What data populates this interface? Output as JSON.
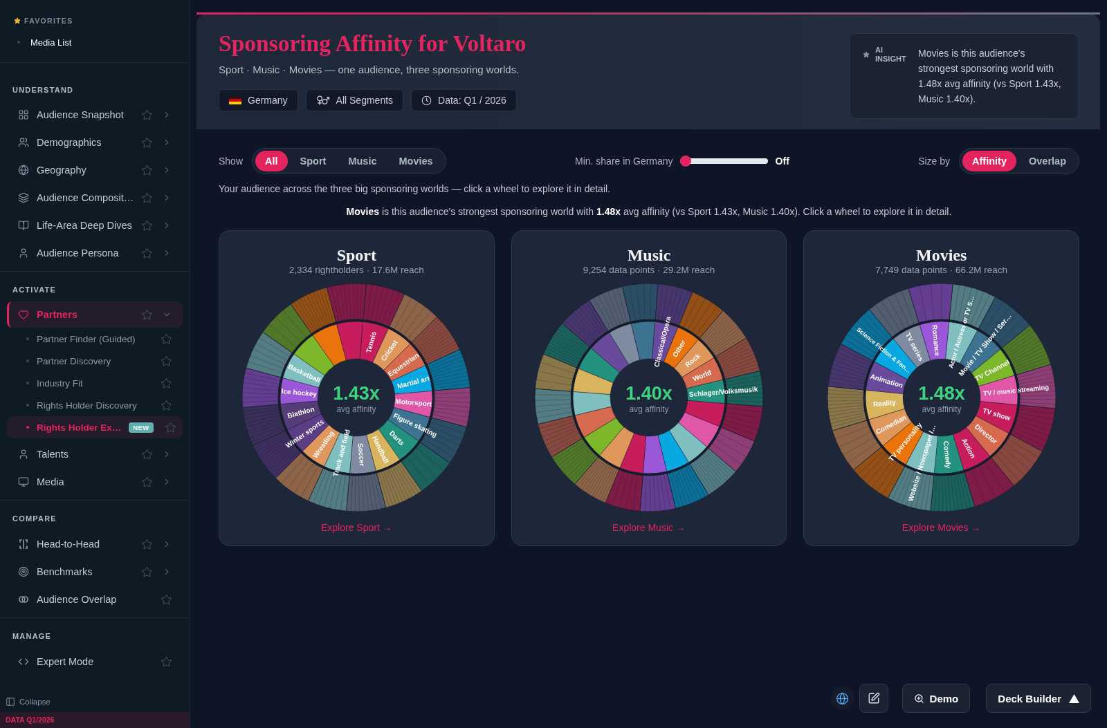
{
  "sidebar": {
    "sections": [
      {
        "kind": "favorites",
        "title": "FAVORITES",
        "items": [
          {
            "label": "Media List",
            "selected": false
          }
        ]
      },
      {
        "kind": "group",
        "title": "UNDERSTAND",
        "items": [
          {
            "label": "Audience Snapshot",
            "selected": false,
            "expanded": false
          },
          {
            "label": "Demographics",
            "selected": false,
            "expanded": false
          },
          {
            "label": "Geography",
            "selected": false,
            "expanded": false
          },
          {
            "label": "Audience Composit…",
            "selected": false,
            "expanded": false
          },
          {
            "label": "Life-Area Deep Dives",
            "selected": false,
            "expanded": false
          },
          {
            "label": "Audience Persona",
            "selected": false,
            "expanded": false
          }
        ]
      },
      {
        "kind": "group",
        "title": "ACTIVATE",
        "items": [
          {
            "label": "Partners",
            "selected": true,
            "expanded": true,
            "children": [
              {
                "label": "Partner Finder (Guided)",
                "selected": false
              },
              {
                "label": "Partner Discovery",
                "selected": false
              },
              {
                "label": "Industry Fit",
                "selected": false
              },
              {
                "label": "Rights Holder Discovery",
                "selected": false
              },
              {
                "label": "Rights Holder Ex…",
                "selected": true,
                "badge": "NEW"
              }
            ]
          },
          {
            "label": "Talents",
            "selected": false,
            "expanded": false
          },
          {
            "label": "Media",
            "selected": false,
            "expanded": false
          }
        ]
      },
      {
        "kind": "group",
        "title": "COMPARE",
        "items": [
          {
            "label": "Head-to-Head",
            "selected": false,
            "expanded": false
          },
          {
            "label": "Benchmarks",
            "selected": false,
            "expanded": false
          },
          {
            "label": "Audience Overlap",
            "selected": false
          }
        ]
      },
      {
        "kind": "group",
        "title": "MANAGE",
        "items": [
          {
            "label": "Expert Mode",
            "selected": false
          }
        ]
      }
    ],
    "collapse": "Collapse",
    "footer": "DATA Q1/2026"
  },
  "header": {
    "title": "Sponsoring Affinity for Voltaro",
    "subtitle": "Sport · Music · Movies — one audience, three sponsoring worlds.",
    "chips": [
      {
        "label": "Germany"
      },
      {
        "label": "All Segments"
      },
      {
        "label": "Data: Q1 / 2026"
      }
    ],
    "insight": {
      "label": "AI INSIGHT",
      "text": "Movies is this audience's strongest sponsoring world with 1.48x avg affinity (vs Sport 1.43x, Music 1.40x)."
    }
  },
  "controls": {
    "show": {
      "label": "Show",
      "options": [
        {
          "label": "All",
          "selected": true
        },
        {
          "label": "Sport",
          "selected": false
        },
        {
          "label": "Music",
          "selected": false
        },
        {
          "label": "Movies",
          "selected": false
        }
      ]
    },
    "min_share": {
      "label": "Min. share in Germany",
      "level": 0,
      "reading": "Off"
    },
    "size_by": {
      "label": "Size by",
      "options": [
        {
          "label": "Affinity",
          "selected": true
        },
        {
          "label": "Overlap",
          "selected": false
        }
      ]
    }
  },
  "intro": "Your audience across the three big sponsoring worlds — click a wheel to explore it in detail.",
  "summary": "**Movies** is this audience's strongest sponsoring world with **1.48x** avg affinity (vs Sport 1.43x, Music 1.40x). Click a wheel to explore it in detail.",
  "worlds": [
    {
      "title": "Sport",
      "stats": "2,334 rightholders · 17.6M reach",
      "affinity": "1.43x",
      "affinity_label": "avg affinity",
      "link": "Explore Sport →",
      "segments": [
        {
          "label": "Tennis",
          "color": "#c81d5c"
        },
        {
          "label": "Cricket",
          "color": "#e0975c"
        },
        {
          "label": "Equestrian",
          "color": "#d66a4f"
        },
        {
          "label": "Martial art",
          "color": "#08a9e3"
        },
        {
          "label": "Motorsport",
          "color": "#e057a8"
        },
        {
          "label": "Figure skating",
          "color": "#3d7290"
        },
        {
          "label": "Darts",
          "color": "#23937f"
        },
        {
          "label": "Handball",
          "color": "#d9b45f"
        },
        {
          "label": "Soccer",
          "color": "#7e8ba0"
        },
        {
          "label": "Track and field",
          "color": "#7fbfc0"
        },
        {
          "label": "Wrestling",
          "color": "#e0975c"
        },
        {
          "label": "Winter sports",
          "color": "#5c3e86"
        },
        {
          "label": "Biathlon",
          "color": "#553e78"
        },
        {
          "label": "Ice hockey",
          "color": "#9a57d8"
        },
        {
          "label": "Basketball",
          "color": "#7fbfc0"
        },
        {
          "color": "#7cb82a"
        },
        {
          "color": "#ea730b"
        },
        {
          "color": "#c81d5c"
        }
      ]
    },
    {
      "title": "Music",
      "stats": "9,254 data points · 29.2M reach",
      "affinity": "1.40x",
      "affinity_label": "avg affinity",
      "link": "Explore Music →",
      "segments": [
        {
          "label": "Classical/Opera",
          "color": "#6a4a9c"
        },
        {
          "label": "Other",
          "color": "#ea730b"
        },
        {
          "label": "Rock",
          "color": "#e0975c"
        },
        {
          "label": "World",
          "color": "#d66a4f"
        },
        {
          "label": "Schlager/Volksmusik",
          "color": "#23937f"
        },
        {
          "color": "#c81d5c"
        },
        {
          "color": "#e057a8"
        },
        {
          "color": "#7fbfc0"
        },
        {
          "color": "#08a9e3"
        },
        {
          "color": "#9a57d8"
        },
        {
          "color": "#c81d5c"
        },
        {
          "color": "#e0975c"
        },
        {
          "color": "#7cb82a"
        },
        {
          "color": "#d66a4f"
        },
        {
          "color": "#7fbfc0"
        },
        {
          "color": "#d9b45f"
        },
        {
          "color": "#23937f"
        },
        {
          "color": "#6a4a9c"
        },
        {
          "color": "#7e8ba0"
        },
        {
          "color": "#3d7290"
        }
      ]
    },
    {
      "title": "Movies",
      "stats": "7,749 data points · 66.2M reach",
      "affinity": "1.48x",
      "affinity_label": "avg affinity",
      "link": "Explore Movies →",
      "segments": [
        {
          "label": "Actor / Actress or TV S…",
          "color": "#7fbfc0"
        },
        {
          "label": "Movie / TV Show / Ser…",
          "color": "#3d7290"
        },
        {
          "label": "TV Channel",
          "color": "#7cb82a"
        },
        {
          "label": "TV / music streaming",
          "color": "#e057a8"
        },
        {
          "label": "TV show",
          "color": "#c81d5c"
        },
        {
          "label": "Director",
          "color": "#d66a4f"
        },
        {
          "label": "Action",
          "color": "#c81d5c"
        },
        {
          "label": "Comedy",
          "color": "#23937f"
        },
        {
          "label": "Website / Newspaper /…",
          "color": "#7fbfc0"
        },
        {
          "label": "TV personality",
          "color": "#ea730b"
        },
        {
          "label": "Comedian",
          "color": "#e0975c"
        },
        {
          "label": "Reality",
          "color": "#d9b45f"
        },
        {
          "label": "Animation",
          "color": "#6a4a9c"
        },
        {
          "label": "Science Fiction & Fan…",
          "color": "#08a9e3"
        },
        {
          "label": "TV series",
          "color": "#7e8ba0"
        },
        {
          "label": "Romance",
          "color": "#9a57d8"
        }
      ]
    }
  ],
  "actions": [
    {
      "label": "Demo"
    },
    {
      "label": "Deck Builder"
    }
  ]
}
